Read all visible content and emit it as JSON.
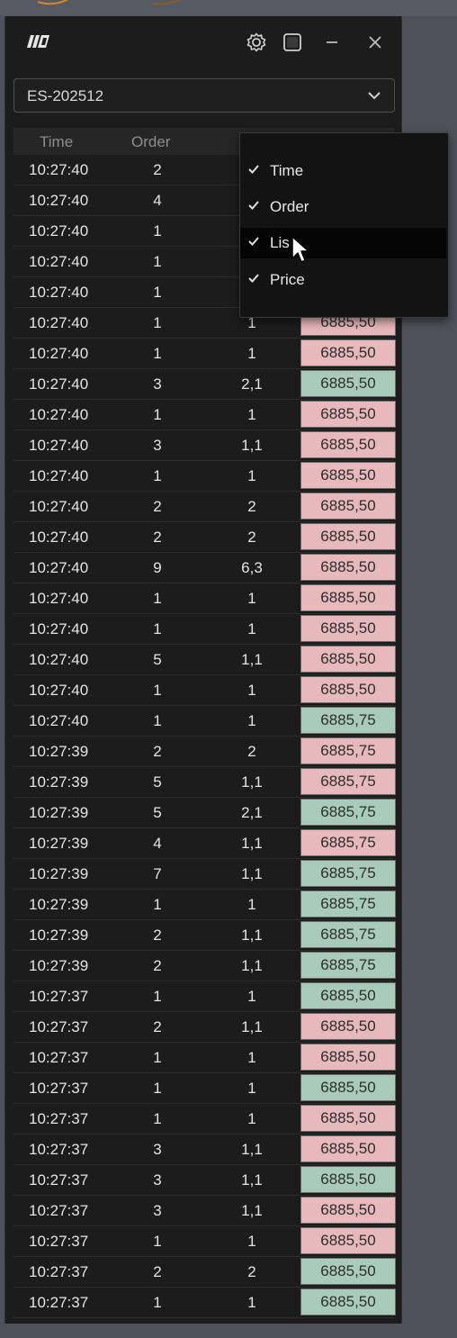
{
  "window": {
    "symbol": "ES-202512"
  },
  "columns": [
    "Time",
    "Order",
    "Lis",
    "Price"
  ],
  "menu": {
    "items": [
      {
        "label": "Time",
        "checked": true
      },
      {
        "label": "Order",
        "checked": true
      },
      {
        "label": "Lis",
        "checked": true
      },
      {
        "label": "Price",
        "checked": true
      }
    ],
    "hovered_item": "Lis"
  },
  "colors": {
    "sell": "#e7b8bc",
    "buy": "#a9cbbc"
  },
  "trades": [
    {
      "time": "10:27:40",
      "order": "2",
      "lis": "",
      "price": "",
      "side": "hidden"
    },
    {
      "time": "10:27:40",
      "order": "4",
      "lis": "",
      "price": "",
      "side": "hidden"
    },
    {
      "time": "10:27:40",
      "order": "1",
      "lis": "",
      "price": "",
      "side": "hidden"
    },
    {
      "time": "10:27:40",
      "order": "1",
      "lis": "",
      "price": "",
      "side": "hidden"
    },
    {
      "time": "10:27:40",
      "order": "1",
      "lis": "",
      "price": "",
      "side": "hidden"
    },
    {
      "time": "10:27:40",
      "order": "1",
      "lis": "1",
      "price": "6885,50",
      "side": "sell"
    },
    {
      "time": "10:27:40",
      "order": "1",
      "lis": "1",
      "price": "6885,50",
      "side": "sell"
    },
    {
      "time": "10:27:40",
      "order": "3",
      "lis": "2,1",
      "price": "6885,50",
      "side": "buy"
    },
    {
      "time": "10:27:40",
      "order": "1",
      "lis": "1",
      "price": "6885,50",
      "side": "sell"
    },
    {
      "time": "10:27:40",
      "order": "3",
      "lis": "1,1",
      "price": "6885,50",
      "side": "sell"
    },
    {
      "time": "10:27:40",
      "order": "1",
      "lis": "1",
      "price": "6885,50",
      "side": "sell"
    },
    {
      "time": "10:27:40",
      "order": "2",
      "lis": "2",
      "price": "6885,50",
      "side": "sell"
    },
    {
      "time": "10:27:40",
      "order": "2",
      "lis": "2",
      "price": "6885,50",
      "side": "sell"
    },
    {
      "time": "10:27:40",
      "order": "9",
      "lis": "6,3",
      "price": "6885,50",
      "side": "sell"
    },
    {
      "time": "10:27:40",
      "order": "1",
      "lis": "1",
      "price": "6885,50",
      "side": "sell"
    },
    {
      "time": "10:27:40",
      "order": "1",
      "lis": "1",
      "price": "6885,50",
      "side": "sell"
    },
    {
      "time": "10:27:40",
      "order": "5",
      "lis": "1,1",
      "price": "6885,50",
      "side": "sell"
    },
    {
      "time": "10:27:40",
      "order": "1",
      "lis": "1",
      "price": "6885,50",
      "side": "sell"
    },
    {
      "time": "10:27:40",
      "order": "1",
      "lis": "1",
      "price": "6885,75",
      "side": "buy"
    },
    {
      "time": "10:27:39",
      "order": "2",
      "lis": "2",
      "price": "6885,75",
      "side": "sell"
    },
    {
      "time": "10:27:39",
      "order": "5",
      "lis": "1,1",
      "price": "6885,75",
      "side": "sell"
    },
    {
      "time": "10:27:39",
      "order": "5",
      "lis": "2,1",
      "price": "6885,75",
      "side": "buy"
    },
    {
      "time": "10:27:39",
      "order": "4",
      "lis": "1,1",
      "price": "6885,75",
      "side": "sell"
    },
    {
      "time": "10:27:39",
      "order": "7",
      "lis": "1,1",
      "price": "6885,75",
      "side": "buy"
    },
    {
      "time": "10:27:39",
      "order": "1",
      "lis": "1",
      "price": "6885,75",
      "side": "buy"
    },
    {
      "time": "10:27:39",
      "order": "2",
      "lis": "1,1",
      "price": "6885,75",
      "side": "buy"
    },
    {
      "time": "10:27:39",
      "order": "2",
      "lis": "1,1",
      "price": "6885,75",
      "side": "buy"
    },
    {
      "time": "10:27:37",
      "order": "1",
      "lis": "1",
      "price": "6885,50",
      "side": "buy"
    },
    {
      "time": "10:27:37",
      "order": "2",
      "lis": "1,1",
      "price": "6885,50",
      "side": "sell"
    },
    {
      "time": "10:27:37",
      "order": "1",
      "lis": "1",
      "price": "6885,50",
      "side": "sell"
    },
    {
      "time": "10:27:37",
      "order": "1",
      "lis": "1",
      "price": "6885,50",
      "side": "buy"
    },
    {
      "time": "10:27:37",
      "order": "1",
      "lis": "1",
      "price": "6885,50",
      "side": "sell"
    },
    {
      "time": "10:27:37",
      "order": "3",
      "lis": "1,1",
      "price": "6885,50",
      "side": "sell"
    },
    {
      "time": "10:27:37",
      "order": "3",
      "lis": "1,1",
      "price": "6885,50",
      "side": "buy"
    },
    {
      "time": "10:27:37",
      "order": "3",
      "lis": "1,1",
      "price": "6885,50",
      "side": "sell"
    },
    {
      "time": "10:27:37",
      "order": "1",
      "lis": "1",
      "price": "6885,50",
      "side": "sell"
    },
    {
      "time": "10:27:37",
      "order": "2",
      "lis": "2",
      "price": "6885,50",
      "side": "buy"
    },
    {
      "time": "10:27:37",
      "order": "1",
      "lis": "1",
      "price": "6885,50",
      "side": "buy"
    }
  ]
}
